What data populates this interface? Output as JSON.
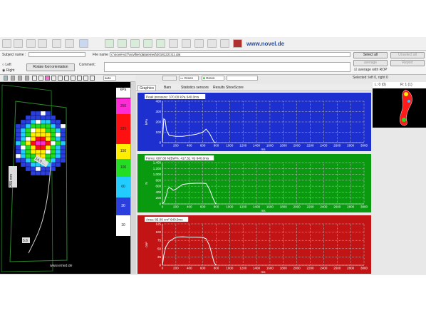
{
  "brand": "www.novel.de",
  "subject_label": "Subject name :",
  "file_label": "File name :",
  "file_value": "c:\\novel-v27\\novflier\\data\\emed\\20181221\\11.dat",
  "comment_label": "Comment :",
  "left_label": "Left",
  "right_label": "Right",
  "rotate_button": "Rotate foot orientation",
  "select_all": "Select all",
  "unselect_all": "Unselect all",
  "average": "average",
  "report": "Report",
  "average_rop": "average with ROP",
  "selected_text": "Selected: left 0, right 0",
  "auto_select": "auto",
  "color_select1": "Green",
  "color_select2": "Green",
  "tabs": [
    "Graphics",
    "Bars",
    "Statistics sensors",
    "Results ShoeScore"
  ],
  "colorscale_unit": "kPa",
  "colorscale": [
    "350",
    "225",
    "150",
    "100",
    "60",
    "30",
    "10"
  ],
  "foot_labels": {
    "angle": "14.0 ...",
    "length": "255 mm",
    "point": "5.6",
    "watermark": "www.emed.de"
  },
  "left_count": "L: 0 (0)",
  "right_count": "R: 1 (1)",
  "charts": [
    {
      "title": "Peak pressure: 370.00 kPa 640.0ms",
      "ylabel": "kPa",
      "bg": "#1e2fd0",
      "ymax": 400,
      "yticks": [
        0,
        100,
        200,
        300,
        400
      ],
      "curve": [
        [
          0,
          5
        ],
        [
          20,
          230
        ],
        [
          40,
          220
        ],
        [
          60,
          120
        ],
        [
          100,
          70
        ],
        [
          200,
          60
        ],
        [
          300,
          60
        ],
        [
          400,
          70
        ],
        [
          500,
          80
        ],
        [
          600,
          100
        ],
        [
          650,
          130
        ],
        [
          700,
          90
        ],
        [
          740,
          40
        ],
        [
          770,
          5
        ],
        [
          800,
          0
        ]
      ]
    },
    {
      "title": "Force: 697.80 N(BW%: 417.51 %) 640.0ms",
      "ylabel": "N",
      "bg": "#0a9a10",
      "ymax": 1400,
      "yticks": [
        0,
        200,
        400,
        600,
        800,
        1000,
        1200,
        1400
      ],
      "curve": [
        [
          0,
          0
        ],
        [
          30,
          80
        ],
        [
          60,
          300
        ],
        [
          80,
          500
        ],
        [
          100,
          560
        ],
        [
          130,
          520
        ],
        [
          160,
          460
        ],
        [
          200,
          500
        ],
        [
          300,
          660
        ],
        [
          400,
          690
        ],
        [
          500,
          700
        ],
        [
          600,
          700
        ],
        [
          650,
          690
        ],
        [
          700,
          500
        ],
        [
          750,
          200
        ],
        [
          780,
          50
        ],
        [
          800,
          0
        ]
      ]
    },
    {
      "title": "Area: 85.00 cm² 640.0ms",
      "ylabel": "cm²",
      "bg": "#c21414",
      "ymax": 125,
      "yticks": [
        0,
        25,
        50,
        75,
        100,
        125
      ],
      "curve": [
        [
          0,
          0
        ],
        [
          20,
          30
        ],
        [
          50,
          55
        ],
        [
          100,
          72
        ],
        [
          200,
          85
        ],
        [
          300,
          86
        ],
        [
          400,
          85
        ],
        [
          500,
          85
        ],
        [
          600,
          84
        ],
        [
          650,
          80
        ],
        [
          700,
          60
        ],
        [
          740,
          30
        ],
        [
          770,
          8
        ],
        [
          800,
          0
        ]
      ]
    }
  ],
  "xticks": [
    0,
    200,
    400,
    600,
    800,
    1000,
    1200,
    1400,
    1600,
    1800,
    2000,
    2200,
    2400,
    2600,
    2800,
    3000
  ],
  "xunit": "ms",
  "colors": {
    "pressure_bg": "#1e2fd0",
    "force_bg": "#0a9a10",
    "area_bg": "#c21414"
  }
}
